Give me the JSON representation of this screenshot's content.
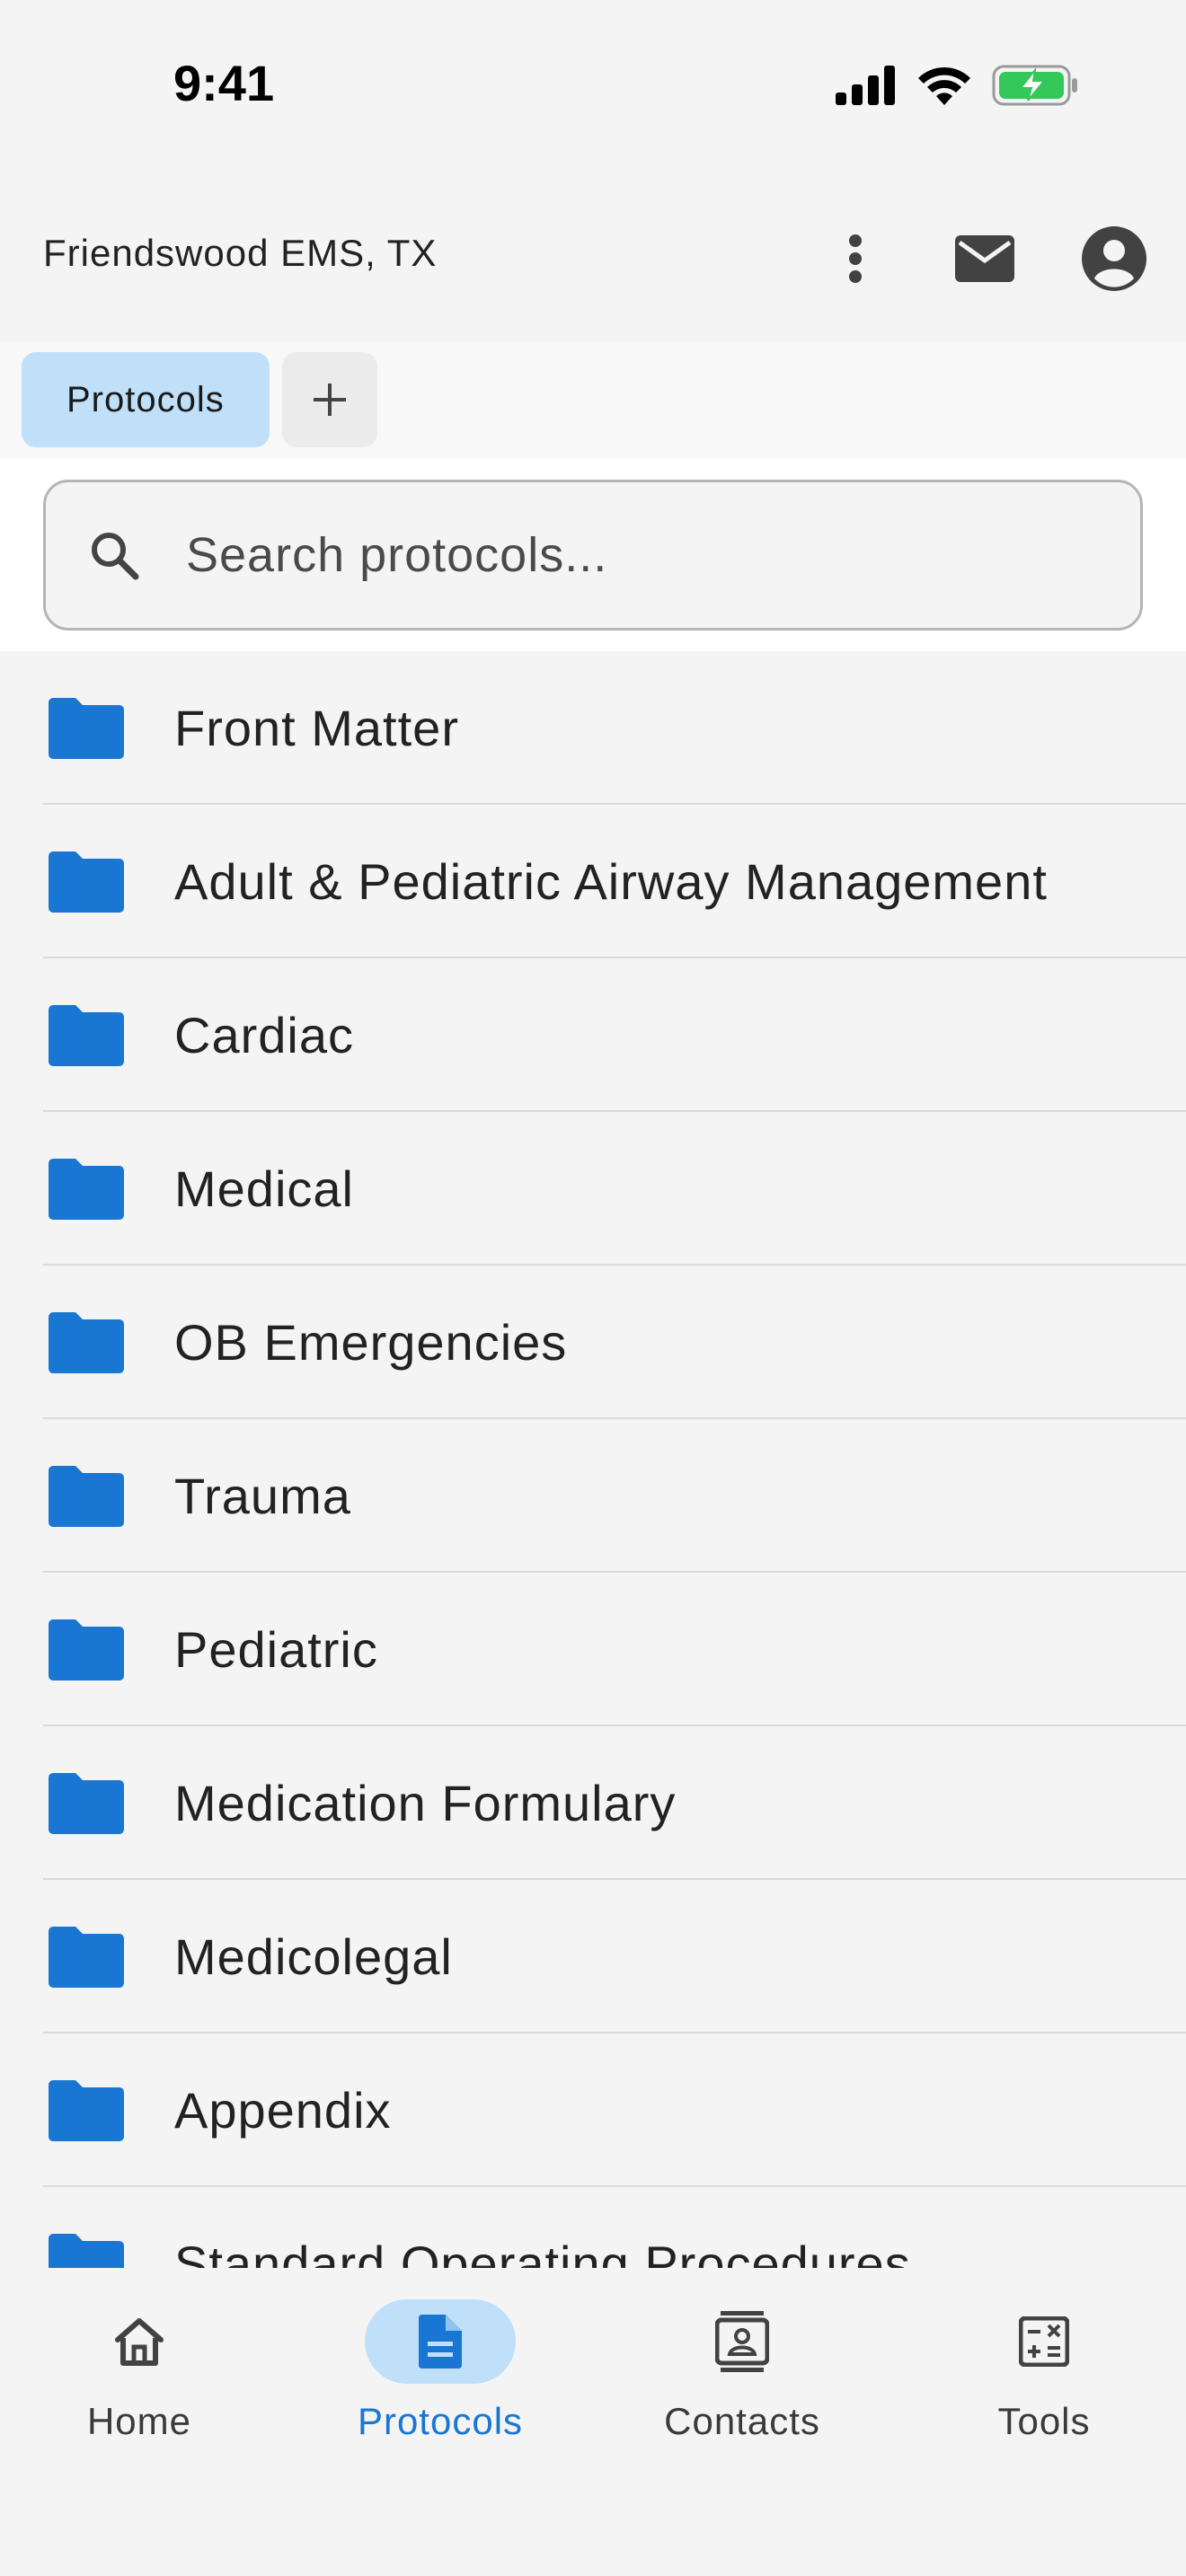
{
  "status_bar": {
    "time": "9:41"
  },
  "header": {
    "title": "Friendswood EMS, TX"
  },
  "tabs": {
    "active_label": "Protocols",
    "add_label": "+"
  },
  "search": {
    "placeholder": "Search protocols..."
  },
  "folders": [
    {
      "label": "Front Matter"
    },
    {
      "label": "Adult & Pediatric Airway Management"
    },
    {
      "label": "Cardiac"
    },
    {
      "label": "Medical"
    },
    {
      "label": "OB Emergencies"
    },
    {
      "label": "Trauma"
    },
    {
      "label": "Pediatric"
    },
    {
      "label": "Medication Formulary"
    },
    {
      "label": "Medicolegal"
    },
    {
      "label": "Appendix"
    },
    {
      "label": "Standard Operating Procedures"
    }
  ],
  "bottom_nav": {
    "home": "Home",
    "protocols": "Protocols",
    "contacts": "Contacts",
    "tools": "Tools"
  },
  "colors": {
    "accent": "#1976d2",
    "folder": "#1976d2",
    "active_chip": "#bfe0f8",
    "battery": "#34c759"
  },
  "icons": [
    "signal-icon",
    "wifi-icon",
    "battery-charging-icon",
    "more-vert-icon",
    "mail-icon",
    "account-icon",
    "search-icon",
    "folder-icon",
    "home-icon",
    "document-icon",
    "contacts-icon",
    "calculator-icon"
  ]
}
